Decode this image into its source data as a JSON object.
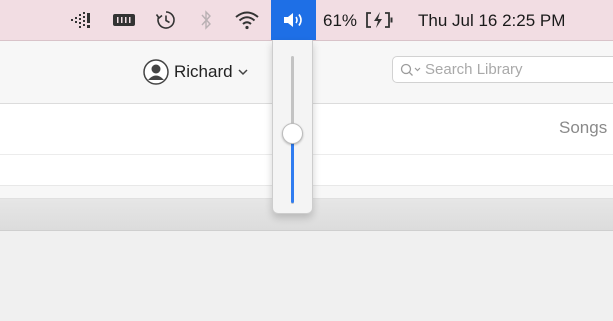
{
  "menubar": {
    "battery_percent": "61%",
    "datetime": "Thu Jul 16  2:25 PM",
    "icons": [
      "activity-monitor-icon",
      "battery-menu-icon",
      "time-machine-icon",
      "bluetooth-icon",
      "wifi-icon",
      "volume-icon",
      "battery-charging-icon"
    ]
  },
  "toolbar": {
    "account_name": "Richard",
    "search_placeholder": "Search Library"
  },
  "content": {
    "songs_label": "Songs"
  },
  "volume": {
    "level": 0.44
  },
  "colors": {
    "menubar_bg": "#f2dde3",
    "accent": "#1e6fe6",
    "slider_fill": "#2f7cf0"
  }
}
